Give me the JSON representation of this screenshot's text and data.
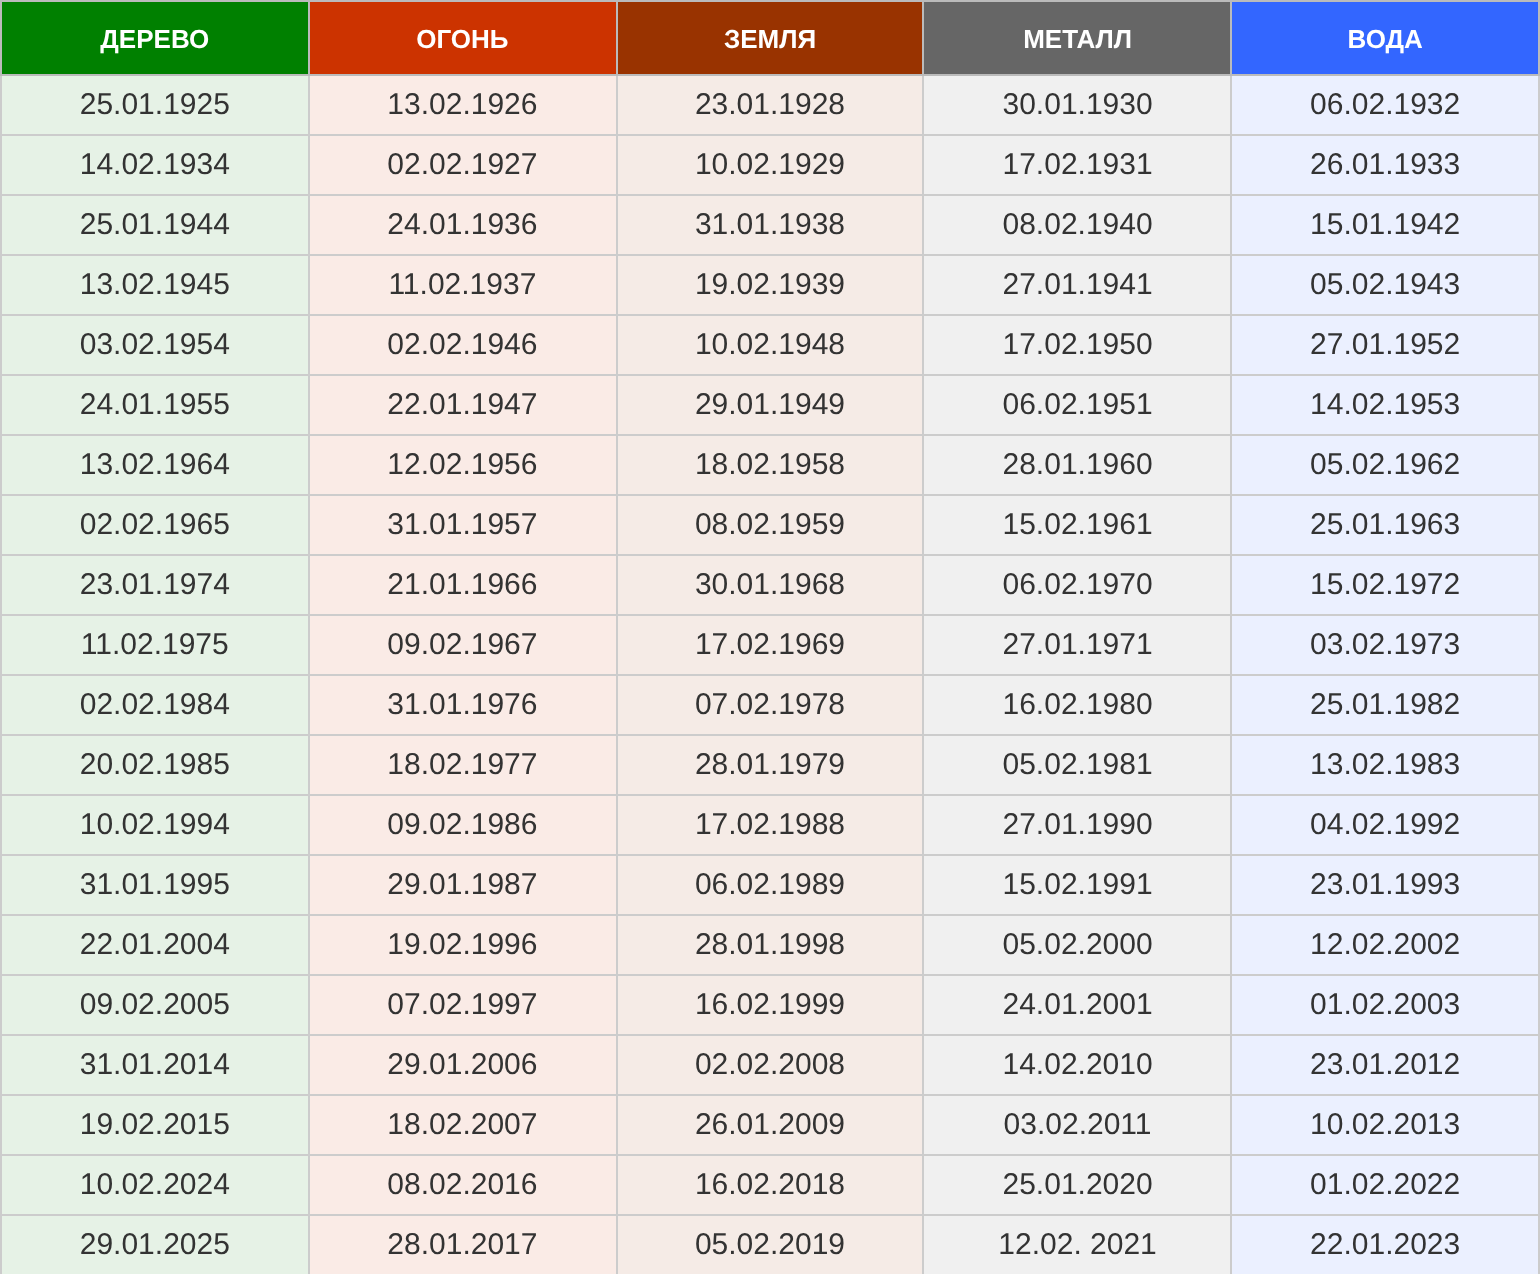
{
  "table": {
    "columns": [
      {
        "label": "ДЕРЕВО",
        "color": "#008000"
      },
      {
        "label": "ОГОНЬ",
        "color": "#cc3300"
      },
      {
        "label": "ЗЕМЛЯ",
        "color": "#993300"
      },
      {
        "label": "МЕТАЛЛ",
        "color": "#666666"
      },
      {
        "label": "ВОДА",
        "color": "#3366ff"
      }
    ],
    "rows": [
      [
        "25.01.1925",
        "13.02.1926",
        "23.01.1928",
        "30.01.1930",
        "06.02.1932"
      ],
      [
        "14.02.1934",
        "02.02.1927",
        "10.02.1929",
        "17.02.1931",
        "26.01.1933"
      ],
      [
        "25.01.1944",
        "24.01.1936",
        "31.01.1938",
        "08.02.1940",
        "15.01.1942"
      ],
      [
        "13.02.1945",
        "11.02.1937",
        "19.02.1939",
        "27.01.1941",
        "05.02.1943"
      ],
      [
        "03.02.1954",
        "02.02.1946",
        "10.02.1948",
        "17.02.1950",
        "27.01.1952"
      ],
      [
        "24.01.1955",
        "22.01.1947",
        "29.01.1949",
        "06.02.1951",
        "14.02.1953"
      ],
      [
        "13.02.1964",
        "12.02.1956",
        "18.02.1958",
        "28.01.1960",
        "05.02.1962"
      ],
      [
        "02.02.1965",
        "31.01.1957",
        "08.02.1959",
        "15.02.1961",
        "25.01.1963"
      ],
      [
        "23.01.1974",
        "21.01.1966",
        "30.01.1968",
        "06.02.1970",
        "15.02.1972"
      ],
      [
        "11.02.1975",
        "09.02.1967",
        "17.02.1969",
        "27.01.1971",
        "03.02.1973"
      ],
      [
        "02.02.1984",
        "31.01.1976",
        "07.02.1978",
        "16.02.1980",
        "25.01.1982"
      ],
      [
        "20.02.1985",
        "18.02.1977",
        "28.01.1979",
        "05.02.1981",
        "13.02.1983"
      ],
      [
        "10.02.1994",
        "09.02.1986",
        "17.02.1988",
        "27.01.1990",
        "04.02.1992"
      ],
      [
        "31.01.1995",
        "29.01.1987",
        "06.02.1989",
        "15.02.1991",
        "23.01.1993"
      ],
      [
        "22.01.2004",
        "19.02.1996",
        "28.01.1998",
        "05.02.2000",
        "12.02.2002"
      ],
      [
        "09.02.2005",
        "07.02.1997",
        "16.02.1999",
        "24.01.2001",
        "01.02.2003"
      ],
      [
        "31.01.2014",
        "29.01.2006",
        "02.02.2008",
        "14.02.2010",
        "23.01.2012"
      ],
      [
        "19.02.2015",
        "18.02.2007",
        "26.01.2009",
        "03.02.2011",
        "10.02.2013"
      ],
      [
        "10.02.2024",
        "08.02.2016",
        "16.02.2018",
        "25.01.2020",
        "01.02.2022"
      ],
      [
        "29.01.2025",
        "28.01.2017",
        "05.02.2019",
        "12.02. 2021",
        "22.01.2023"
      ]
    ]
  }
}
